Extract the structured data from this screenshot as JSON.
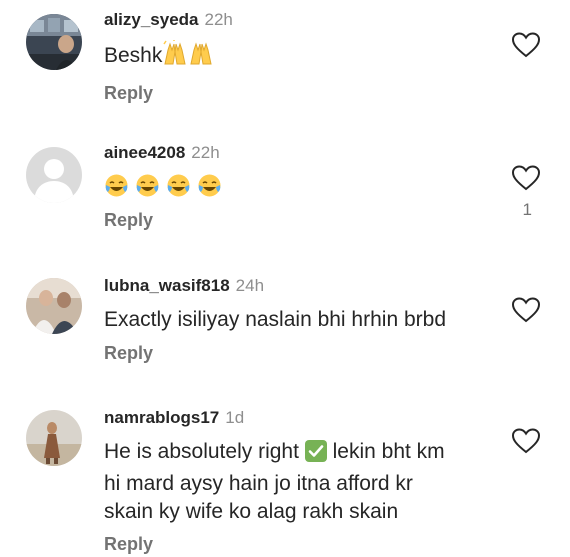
{
  "comments": [
    {
      "username": "alizy_syeda",
      "time": "22h",
      "text": "Beshk",
      "emoji_icons": [
        "raising-hands-icon",
        "raising-hands-icon"
      ],
      "reply_label": "Reply",
      "like_count": ""
    },
    {
      "username": "ainee4208",
      "time": "22h",
      "text": "",
      "emoji_icons": [
        "tears-of-joy-icon",
        "tears-of-joy-icon",
        "tears-of-joy-icon",
        "tears-of-joy-icon"
      ],
      "reply_label": "Reply",
      "like_count": "1"
    },
    {
      "username": "lubna_wasif818",
      "time": "24h",
      "text": "Exactly isiliyay naslain bhi hrhin brbd",
      "reply_label": "Reply",
      "like_count": ""
    },
    {
      "username": "namrablogs17",
      "time": "1d",
      "text_line1_a": "He is absolutely right",
      "text_line1_icon": "check-mark-button-icon",
      "text_line1_b": "lekin bht km",
      "text_line2": "hi mard aysy hain jo itna afford kr",
      "text_line3": "skain ky wife ko alag rakh skain",
      "reply_label": "Reply",
      "like_count": ""
    }
  ],
  "colors": {
    "text": "#262626",
    "secondary": "#8e8e8e",
    "reply": "#737373",
    "check_green": "#77b255",
    "emoji_yellow": "#ffcc4d"
  }
}
